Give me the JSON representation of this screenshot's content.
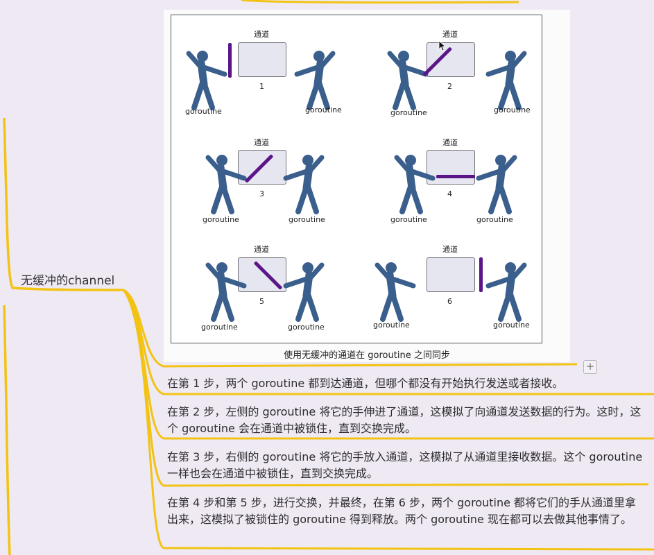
{
  "topic": {
    "label": "无缓冲的channel"
  },
  "figure": {
    "caption": "使用无缓冲的通道在 goroutine 之间同步",
    "steps": [
      {
        "channel_label": "通道",
        "number": "1",
        "left_actor": "goroutine",
        "right_actor": "goroutine"
      },
      {
        "channel_label": "通道",
        "number": "2",
        "left_actor": "goroutine",
        "right_actor": "goroutine"
      },
      {
        "channel_label": "通道",
        "number": "3",
        "left_actor": "goroutine",
        "right_actor": "goroutine"
      },
      {
        "channel_label": "通道",
        "number": "4",
        "left_actor": "goroutine",
        "right_actor": "goroutine"
      },
      {
        "channel_label": "通道",
        "number": "5",
        "left_actor": "goroutine",
        "right_actor": "goroutine"
      },
      {
        "channel_label": "通道",
        "number": "6",
        "left_actor": "goroutine",
        "right_actor": "goroutine"
      }
    ]
  },
  "expand_button": {
    "label": "+"
  },
  "notes": [
    {
      "text": "在第 1 步，两个 goroutine 都到达通道，但哪个都没有开始执行发送或者接收。"
    },
    {
      "text": "在第 2 步，左侧的 goroutine 将它的手伸进了通道，这模拟了向通道发送数据的行为。这时，这个 goroutine 会在通道中被锁住，直到交换完成。"
    },
    {
      "text": "在第 3 步，右侧的 goroutine 将它的手放入通道，这模拟了从通道里接收数据。这个 goroutine 一样也会在通道中被锁住，直到交换完成。"
    },
    {
      "text": "在第 4 步和第 5 步，进行交换，并最终，在第 6 步，两个 goroutine 都将它们的手从通道里拿出来，这模拟了被锁住的 goroutine 得到释放。两个 goroutine 现在都可以去做其他事情了。"
    }
  ],
  "colors": {
    "branch": "#f2c313",
    "stick": "#5b1588",
    "figure": "#3b5f8c",
    "background": "#efe9f4"
  }
}
